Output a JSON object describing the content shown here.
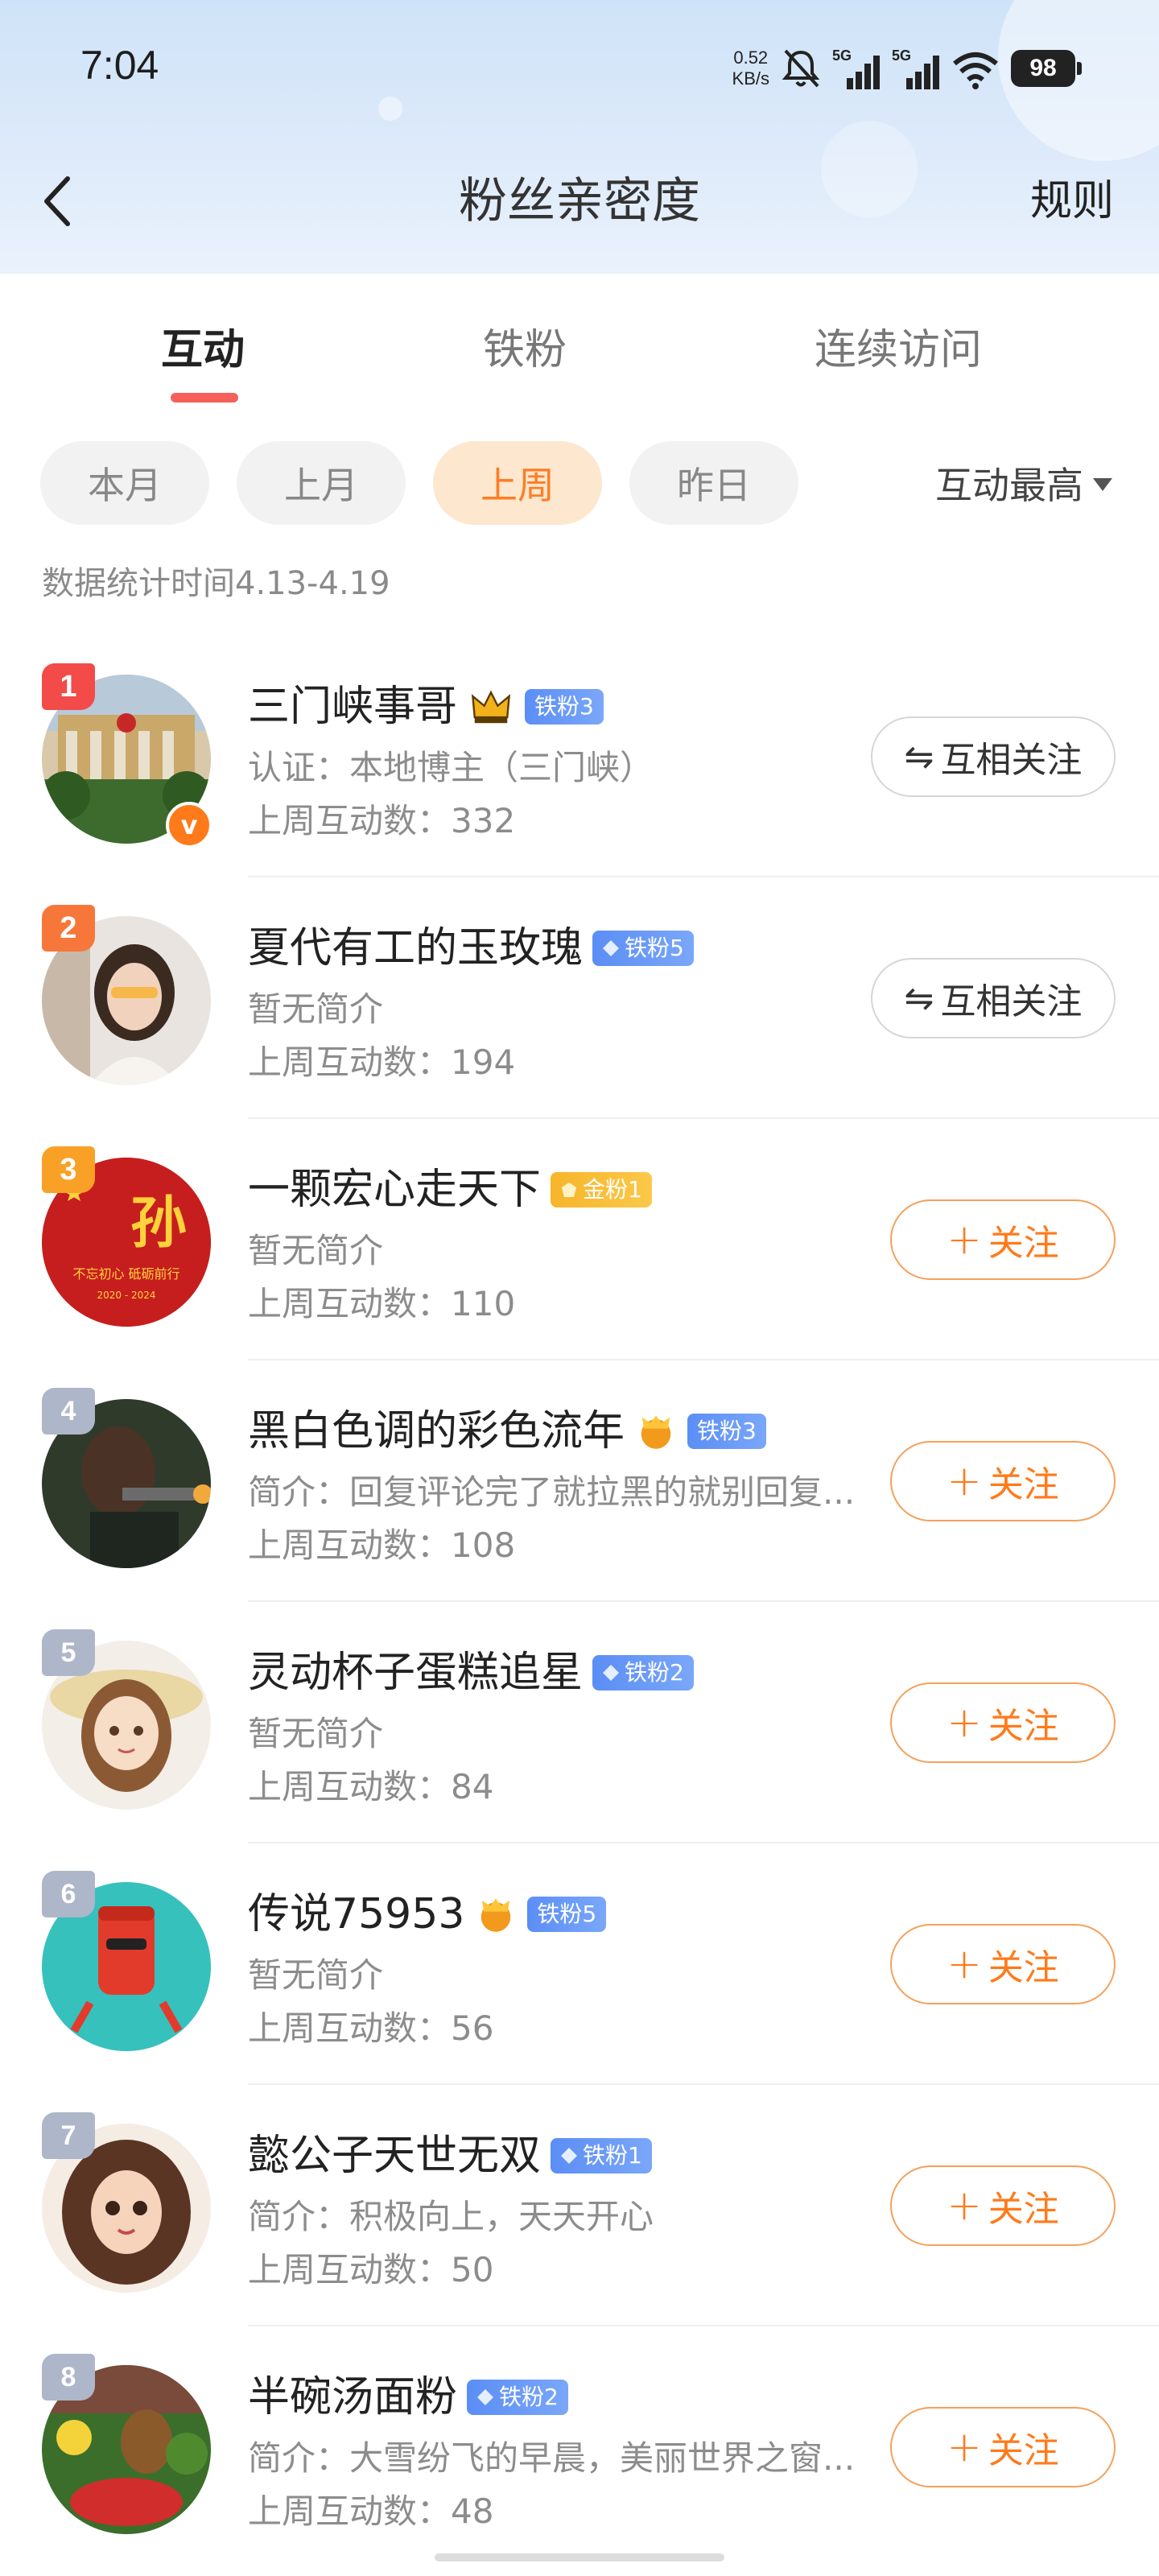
{
  "status_bar": {
    "time": "7:04",
    "speed_value": "0.52",
    "speed_unit": "KB/s",
    "signal1": "5G",
    "signal2": "5G",
    "battery": "98"
  },
  "nav": {
    "title": "粉丝亲密度",
    "rule": "规则"
  },
  "tabs": [
    "互动",
    "铁粉",
    "连续访问"
  ],
  "active_tab": "互动",
  "chips": [
    "本月",
    "上月",
    "上周",
    "昨日"
  ],
  "selected_chip": "上周",
  "sort_label": "互动最高",
  "stats_time": "数据统计时间4.13-4.19",
  "colors": {
    "accent": "#ff7a1a",
    "tab_underline": "#f5605b",
    "iron_badge": "#5b8ef5",
    "gold_badge": "#f7b52a"
  },
  "fans": [
    {
      "rank": "1",
      "name": "三门峡事哥",
      "badge_icon": "crown-icon",
      "badge_text": "铁粉3",
      "badge_type": "iron",
      "desc": "认证：本地博主（三门峡）",
      "count": "上周互动数：332",
      "button": "互相关注",
      "button_type": "mutual",
      "verified": true
    },
    {
      "rank": "2",
      "name": "夏代有工的玉玫瑰",
      "badge_icon": "diamond-icon",
      "badge_text": "铁粉5",
      "badge_type": "iron",
      "desc": "暂无简介",
      "count": "上周互动数：194",
      "button": "互相关注",
      "button_type": "mutual",
      "verified": false
    },
    {
      "rank": "3",
      "name": "一颗宏心走天下",
      "badge_icon": "gold-gem-icon",
      "badge_text": "金粉1",
      "badge_type": "gold",
      "desc": "暂无简介",
      "count": "上周互动数：110",
      "button": "关注",
      "button_type": "follow",
      "verified": false
    },
    {
      "rank": "4",
      "name": "黑白色调的彩色流年",
      "badge_icon": "crown-icon",
      "badge_text": "铁粉3",
      "badge_type": "iron",
      "desc": "简介：回复评论完了就拉黑的就别回复...",
      "count": "上周互动数：108",
      "button": "关注",
      "button_type": "follow",
      "verified": false
    },
    {
      "rank": "5",
      "name": "灵动杯子蛋糕追星",
      "badge_icon": "diamond-icon",
      "badge_text": "铁粉2",
      "badge_type": "iron",
      "desc": "暂无简介",
      "count": "上周互动数：84",
      "button": "关注",
      "button_type": "follow",
      "verified": false
    },
    {
      "rank": "6",
      "name": "传说75953",
      "badge_icon": "crown-icon",
      "badge_text": "铁粉5",
      "badge_type": "iron",
      "desc": "暂无简介",
      "count": "上周互动数：56",
      "button": "关注",
      "button_type": "follow",
      "verified": false
    },
    {
      "rank": "7",
      "name": "懿公子天世无双",
      "badge_icon": "diamond-icon",
      "badge_text": "铁粉1",
      "badge_type": "iron",
      "desc": "简介：积极向上，天天开心",
      "count": "上周互动数：50",
      "button": "关注",
      "button_type": "follow",
      "verified": false
    },
    {
      "rank": "8",
      "name": "半碗汤面粉",
      "badge_icon": "diamond-icon",
      "badge_text": "铁粉2",
      "badge_type": "iron",
      "desc": "简介：大雪纷飞的早晨，美丽世界之窗...",
      "count": "上周互动数：48",
      "button": "关注",
      "button_type": "follow",
      "verified": false
    }
  ],
  "avatar_decor": {
    "fan3_avatar_text": "孙",
    "fan3_avatar_small": "不忘初心  砥砺前行",
    "fan3_avatar_year": "2020 - 2024"
  }
}
